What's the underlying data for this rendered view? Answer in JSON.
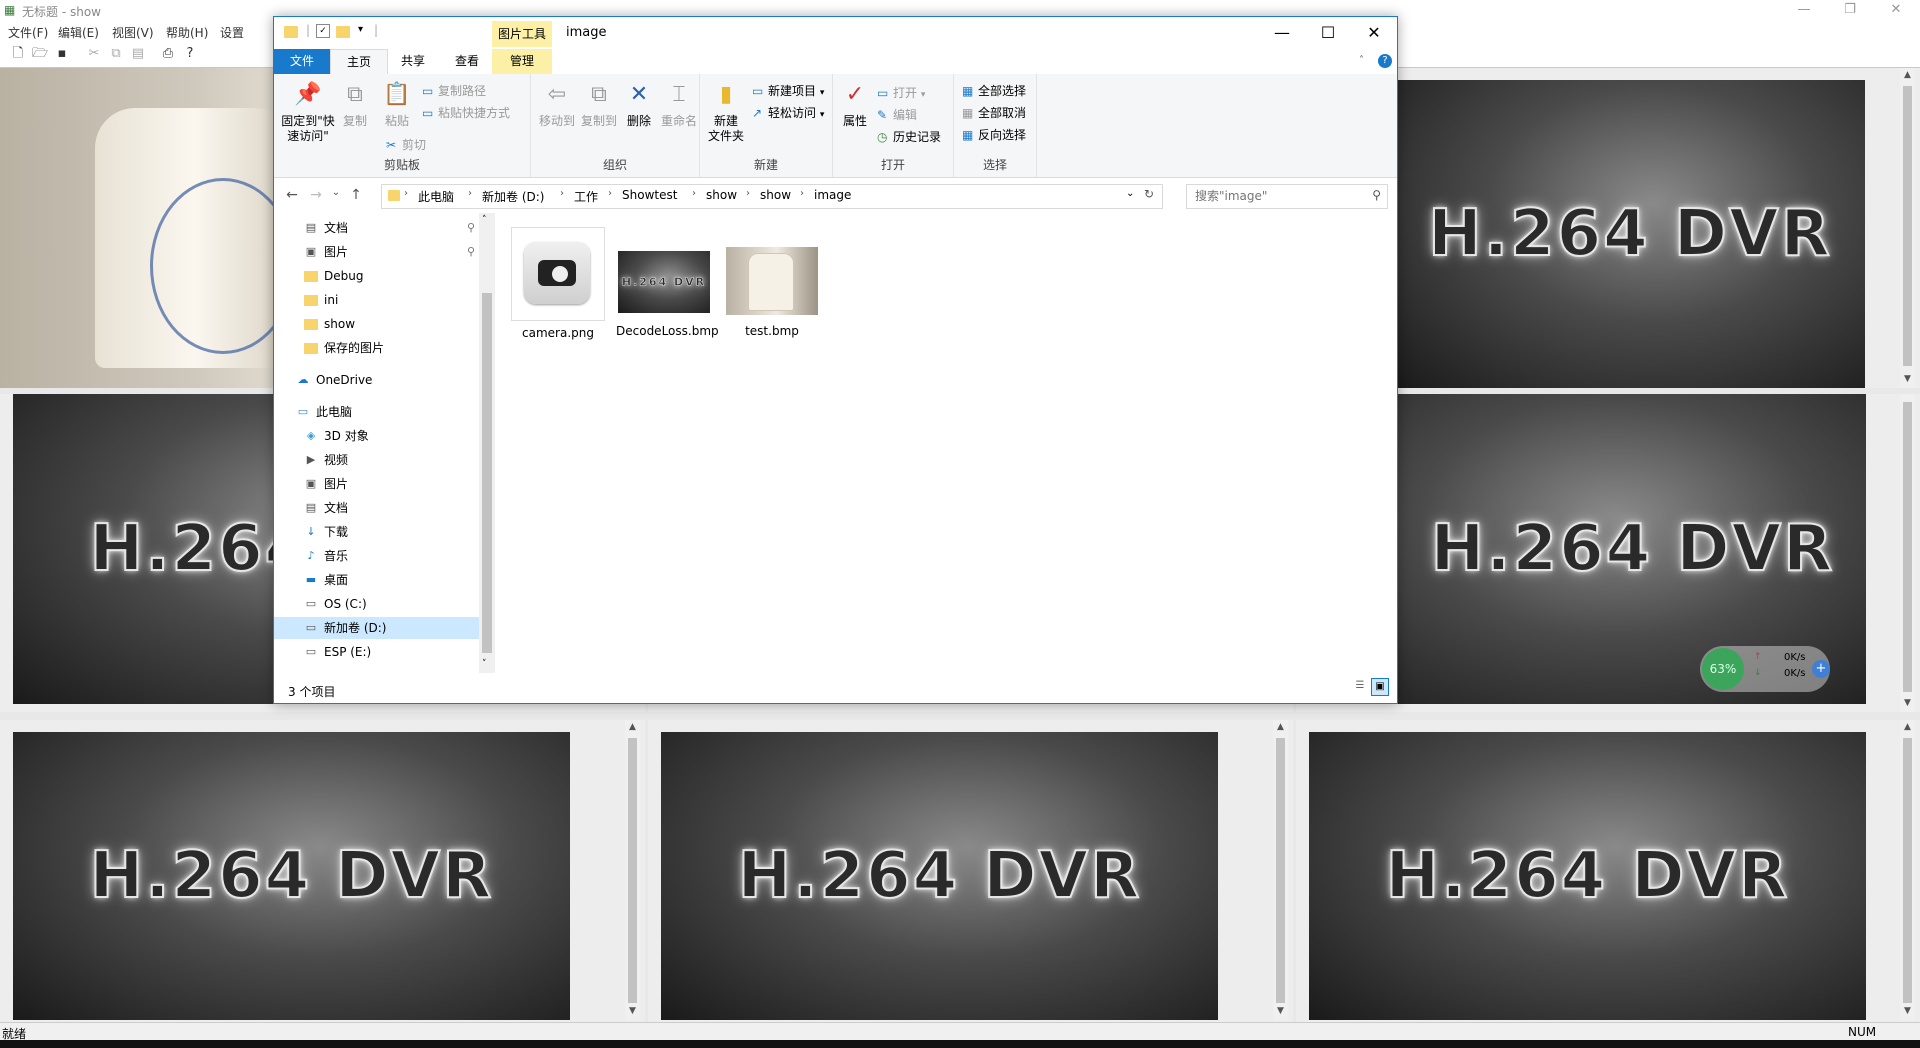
{
  "app": {
    "title": "无标题 - show",
    "menu": [
      "文件(F)",
      "编辑(E)",
      "视图(V)",
      "帮助(H)",
      "设置"
    ],
    "status_left": "就绪",
    "status_right": "NUM",
    "video_overlay": "H.264 DVR"
  },
  "explorer": {
    "title": "image",
    "context_tab": "图片工具",
    "tabs": [
      "文件",
      "主页",
      "共享",
      "查看",
      "管理"
    ],
    "ribbon": {
      "clipboard": {
        "label": "剪贴板",
        "pin": "固定到\"快速访问\"",
        "copy": "复制",
        "paste": "粘贴",
        "copy_path": "复制路径",
        "paste_shortcut": "粘贴快捷方式",
        "cut": "剪切"
      },
      "organize": {
        "label": "组织",
        "move_to": "移动到",
        "copy_to": "复制到",
        "delete": "删除",
        "rename": "重命名"
      },
      "new": {
        "label": "新建",
        "new_folder": "新建\n文件夹",
        "new_item": "新建项目",
        "easy_access": "轻松访问"
      },
      "open": {
        "label": "打开",
        "properties": "属性",
        "open": "打开",
        "edit": "编辑",
        "history": "历史记录"
      },
      "select": {
        "label": "选择",
        "select_all": "全部选择",
        "select_none": "全部取消",
        "invert": "反向选择"
      }
    },
    "breadcrumb": [
      "此电脑",
      "新加卷 (D:)",
      "工作",
      "Showtest",
      "show",
      "show",
      "image"
    ],
    "search_placeholder": "搜索\"image\"",
    "nav_items": [
      {
        "label": "文档",
        "icon": "document-icon"
      },
      {
        "label": "图片",
        "icon": "picture-icon"
      },
      {
        "label": "Debug",
        "icon": "folder-icon"
      },
      {
        "label": "ini",
        "icon": "folder-icon"
      },
      {
        "label": "show",
        "icon": "folder-icon"
      },
      {
        "label": "保存的图片",
        "icon": "folder-icon"
      },
      {
        "label": "OneDrive",
        "icon": "cloud-icon"
      },
      {
        "label": "此电脑",
        "icon": "computer-icon"
      },
      {
        "label": "3D 对象",
        "icon": "cube-icon"
      },
      {
        "label": "视频",
        "icon": "video-icon"
      },
      {
        "label": "图片",
        "icon": "picture-icon"
      },
      {
        "label": "文档",
        "icon": "document-icon"
      },
      {
        "label": "下载",
        "icon": "download-icon"
      },
      {
        "label": "音乐",
        "icon": "music-icon"
      },
      {
        "label": "桌面",
        "icon": "desktop-icon"
      },
      {
        "label": "OS (C:)",
        "icon": "drive-icon"
      },
      {
        "label": "新加卷 (D:)",
        "icon": "drive-icon"
      },
      {
        "label": "ESP (E:)",
        "icon": "drive-icon"
      }
    ],
    "files": [
      {
        "name": "camera.png"
      },
      {
        "name": "DecodeLoss.bmp"
      },
      {
        "name": "test.bmp"
      }
    ],
    "item_count": "3 个项目"
  },
  "speed_widget": {
    "percent": "63%",
    "up": "0K/s",
    "down": "0K/s"
  }
}
